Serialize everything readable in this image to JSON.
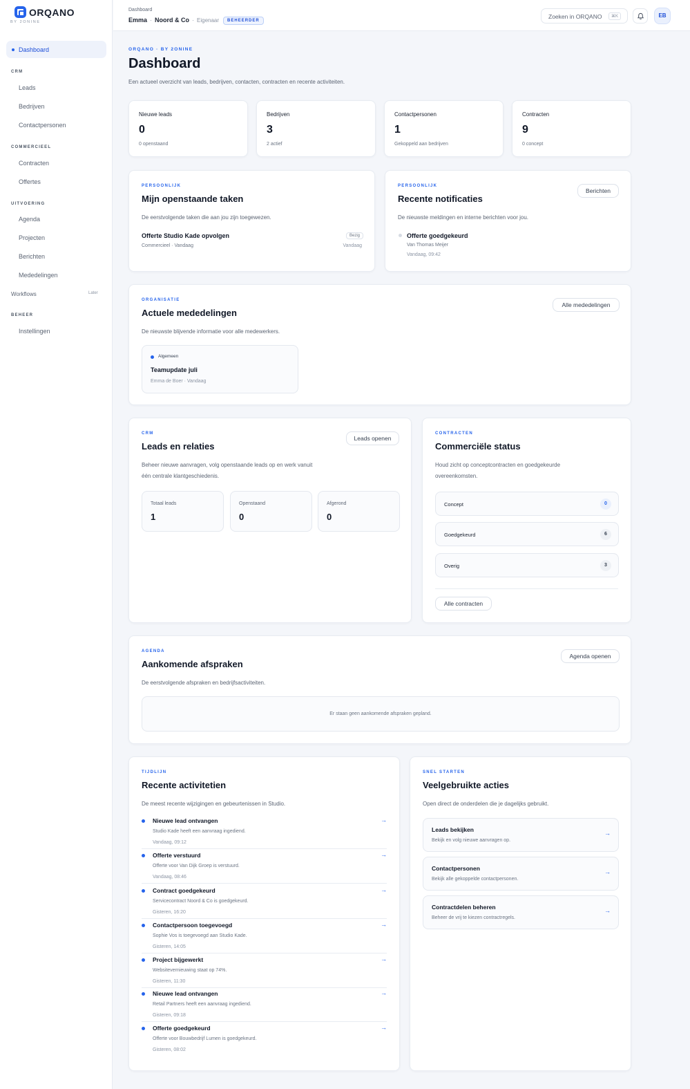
{
  "brand": {
    "name": "ORQANO",
    "sub": "BY 2ONINE"
  },
  "sidebar": {
    "active": "Dashboard",
    "sections": [
      {
        "title": "CRM",
        "items": [
          "Leads",
          "Bedrijven",
          "Contactpersonen"
        ]
      },
      {
        "title": "COMMERCIEEL",
        "items": [
          "Contracten",
          "Offertes"
        ]
      },
      {
        "title": "UITVOERING",
        "items": [
          "Agenda",
          "Projecten",
          "Berichten",
          "Mededelingen"
        ]
      },
      {
        "title": "BEHEER",
        "items": [
          "Instellingen"
        ]
      }
    ],
    "workflows": {
      "label": "Workflows",
      "badge": "Later"
    }
  },
  "topbar": {
    "crumb": "Dashboard",
    "user": "Emma",
    "org": "Noord & Co",
    "role": "Eigenaar",
    "badge": "BEHEERDER",
    "search_placeholder": "Zoeken in ORQANO",
    "search_kbd": "⌘K",
    "avatar": "EB"
  },
  "header": {
    "eyebrow": "ORQANO · BY 2ONINE",
    "title": "Dashboard",
    "subtitle": "Een actueel overzicht van leads, bedrijven, contacten, contracten en recente activiteiten."
  },
  "stats": [
    {
      "label": "Nieuwe leads",
      "value": "0",
      "sub": "0 openstaand"
    },
    {
      "label": "Bedrijven",
      "value": "3",
      "sub": "2 actief"
    },
    {
      "label": "Contactpersonen",
      "value": "1",
      "sub": "Gekoppeld aan bedrijven"
    },
    {
      "label": "Contracten",
      "value": "9",
      "sub": "0 concept"
    }
  ],
  "tasks": {
    "eyebrow": "PERSOONLIJK",
    "title": "Mijn openstaande taken",
    "desc": "De eerstvolgende taken die aan jou zijn toegewezen.",
    "item": {
      "title": "Offerte Studio Kade opvolgen",
      "meta": "Commercieel · Vandaag",
      "badge": "Bezig",
      "date": "Vandaag"
    }
  },
  "notifications": {
    "eyebrow": "PERSOONLIJK",
    "title": "Recente notificaties",
    "desc": "De nieuwste meldingen en interne berichten voor jou.",
    "button": "Berichten",
    "item": {
      "title": "Offerte goedgekeurd",
      "sub": "Van Thomas Meijer",
      "time": "Vandaag, 09:42"
    }
  },
  "announcements": {
    "eyebrow": "ORGANISATIE",
    "title": "Actuele mededelingen",
    "desc": "De nieuwste blijvende informatie voor alle medewerkers.",
    "button": "Alle mededelingen",
    "item": {
      "tag": "Algemeen",
      "title": "Teamupdate juli",
      "meta": "Emma de Boer · Vandaag"
    }
  },
  "leads": {
    "eyebrow": "CRM",
    "title": "Leads en relaties",
    "desc1": "Beheer nieuwe aanvragen, volg openstaande leads op en werk vanuit",
    "desc2": "één centrale klantgeschiedenis.",
    "button": "Leads openen",
    "tiles": [
      {
        "label": "Totaal leads",
        "value": "1"
      },
      {
        "label": "Openstaand",
        "value": "0"
      },
      {
        "label": "Afgerond",
        "value": "0"
      }
    ]
  },
  "contracts": {
    "eyebrow": "CONTRACTEN",
    "title": "Commerciële status",
    "desc1": "Houd zicht op conceptcontracten en goedgekeurde",
    "desc2": "overeenkomsten.",
    "rows": [
      {
        "label": "Concept",
        "count": "0"
      },
      {
        "label": "Goedgekeurd",
        "count": "6"
      },
      {
        "label": "Overig",
        "count": "3"
      }
    ],
    "button": "Alle contracten"
  },
  "agenda": {
    "eyebrow": "AGENDA",
    "title": "Aankomende afspraken",
    "desc": "De eerstvolgende afspraken en bedrijfsactiviteiten.",
    "button": "Agenda openen",
    "empty": "Er staan geen aankomende afspraken gepland."
  },
  "timeline": {
    "eyebrow": "TIJDLIJN",
    "title": "Recente activitetien",
    "desc": "De meest recente wijzigingen en gebeurtenissen in Studio.",
    "items": [
      {
        "title": "Nieuwe lead ontvangen",
        "sub": "Studio Kade heeft een aanvraag ingediend.",
        "time": "Vandaag, 09:12"
      },
      {
        "title": "Offerte verstuurd",
        "sub": "Offerte voor Van Dijk Groep is verstuurd.",
        "time": "Vandaag, 08:46"
      },
      {
        "title": "Contract goedgekeurd",
        "sub": "Servicecontract Noord & Co is goedgekeurd.",
        "time": "Gisteren, 16:20"
      },
      {
        "title": "Contactpersoon toegevoegd",
        "sub": "Sophie Vos is toegevoegd aan Studio Kade.",
        "time": "Gisteren, 14:05"
      },
      {
        "title": "Project bijgewerkt",
        "sub": "Websitevernieuwing staat op 74%.",
        "time": "Gisteren, 11:30"
      },
      {
        "title": "Nieuwe lead ontvangen",
        "sub": "Retail Partners heeft een aanvraag ingediend.",
        "time": "Gisteren, 09:18"
      },
      {
        "title": "Offerte goedgekeurd",
        "sub": "Offerte voor Bouwbedrijf Lumen is goedgekeurd.",
        "time": "Gisteren, 08:02"
      }
    ]
  },
  "quick": {
    "eyebrow": "SNEL STARTEN",
    "title": "Veelgebruikte acties",
    "desc": "Open direct de onderdelen die je dagelijks gebruikt.",
    "items": [
      {
        "title": "Leads bekijken",
        "sub": "Bekijk en volg nieuwe aanvragen op."
      },
      {
        "title": "Contactpersonen",
        "sub": "Bekijk alle gekoppelde contactpersonen."
      },
      {
        "title": "Contractdelen beheren",
        "sub": "Beheer de vrij te kiezen contractregels."
      }
    ]
  },
  "icons": {
    "arrow": "arrow-right-icon",
    "bell": "bell-icon",
    "logo": "orqano-logo-icon"
  },
  "colors": {
    "accent": "#2563eb",
    "background": "#f4f6fa"
  }
}
